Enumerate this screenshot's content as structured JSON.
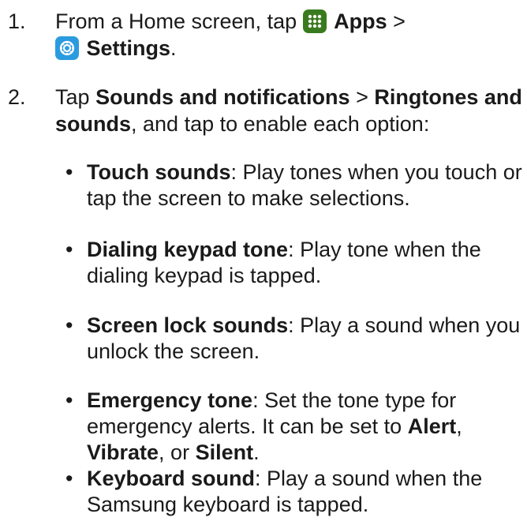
{
  "step1": {
    "number": "1.",
    "text_before": "From a Home screen, tap",
    "apps_label": "Apps",
    "separator": ">",
    "settings_label": "Settings",
    "end": "."
  },
  "step2": {
    "number": "2.",
    "tap": "Tap",
    "sounds_notifications": "Sounds and notifications",
    "separator": ">",
    "ringtones_part1": "Ringtones and",
    "ringtones_part2": "sounds",
    "rest": ", and tap to enable each option:"
  },
  "bullets": [
    {
      "title": "Touch sounds",
      "line1": ": Play tones when you touch or",
      "line2": "tap the screen to make selections."
    },
    {
      "title": "Dialing keypad tone",
      "line1": ": Play tone when the",
      "line2": "dialing keypad is tapped."
    },
    {
      "title": "Screen lock sounds",
      "line1": ": Play a sound when you",
      "line2": "unlock the screen."
    },
    {
      "title": "Emergency tone",
      "line1": ": Set the tone type for",
      "line2": "emergency alerts. It can be set to ",
      "opt1": "Alert",
      "comma": ",",
      "opt2": "Vibrate",
      "or": ", or ",
      "opt3": "Silent",
      "end": "."
    },
    {
      "title": "Keyboard sound",
      "line1": ": Play a sound when the",
      "line2": "Samsung keyboard is tapped."
    }
  ],
  "bullet_glyph": "•",
  "icons": {
    "apps": "apps-grid-icon",
    "settings": "settings-gear-icon"
  },
  "colors": {
    "text": "#1a1a1a",
    "apps_icon_bg": "#3a7a1e",
    "settings_icon_bg": "#2b9be0"
  }
}
